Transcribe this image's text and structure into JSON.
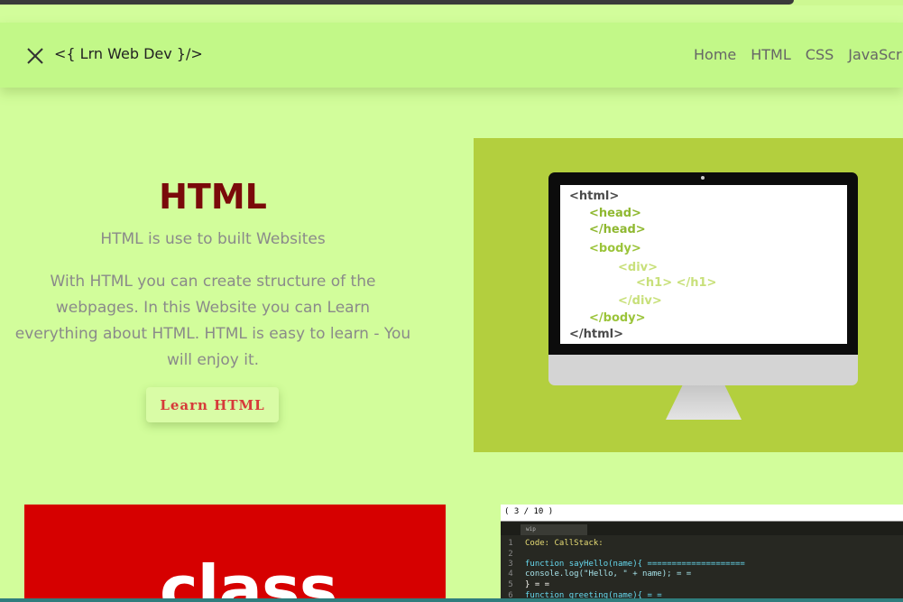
{
  "navbar": {
    "brand": "<{ Lrn Web Dev }/>",
    "links": [
      "Home",
      "HTML",
      "CSS",
      "JavaScr"
    ]
  },
  "hero": {
    "title": "HTML",
    "subtitle": "HTML is use to built Websites",
    "description": "With HTML you can create structure of the webpages. In this Website you can Learn everything about HTML. HTML is easy to learn - You will enjoy it.",
    "button_label": "Learn HTML"
  },
  "monitor_code": [
    "<html>",
    "<head>",
    "</head>",
    "<body>",
    "<div>",
    "<h1> </h1>",
    "</div>",
    "</body>",
    "</html>"
  ],
  "cards": {
    "red_card_word": "class",
    "editor": {
      "header": "( 3 / 10 )",
      "tab": "wip",
      "lines": [
        {
          "n": "1",
          "code": "Code:                        CallStack:"
        },
        {
          "n": "2",
          "code": ""
        },
        {
          "n": "3",
          "code": "function sayHello(name){              ===================="
        },
        {
          "n": "4",
          "code": "    console.log(\"Hello, \" + name);    =                  ="
        },
        {
          "n": "5",
          "code": "}                                     =                  ="
        },
        {
          "n": "6",
          "code": "function greeting(name){              =                  ="
        }
      ]
    }
  },
  "colors": {
    "page_bg": "#d2fd9b",
    "navbar_bg": "#c2f888",
    "title": "#7a0a0a",
    "button_text": "#d63a3a",
    "image_bg": "#b3cf3e",
    "code_green": "#9bc43a",
    "code_lightgreen": "#c8e07a",
    "red_card": "#d60000"
  }
}
